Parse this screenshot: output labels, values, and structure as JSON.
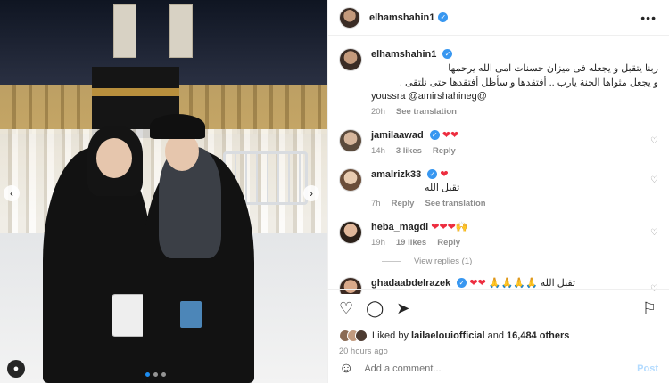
{
  "post": {
    "username": "elhamshahin1",
    "caption_ar_line1": "ربنا يتقبل و يجعله فى ميزان حسنات امى الله يرحمها",
    "caption_ar_line2": "و يجعل مثواها الجنة يارب .. أفتقدها و سأظل أفتقدها حتى نلتقى .",
    "caption_tag": "youssra @amirshahineg@",
    "caption_time": "20h",
    "see_translation": "See translation"
  },
  "comments": [
    {
      "username": "jamilaawad",
      "text": "❤❤",
      "time": "14h",
      "likes": "3 likes",
      "reply": "Reply"
    },
    {
      "username": "amalrizk33",
      "text": "❤",
      "arabic": "تقبل الله",
      "time": "7h",
      "reply": "Reply",
      "see_translation": "See translation"
    },
    {
      "username": "heba_magdi",
      "text": "❤❤❤🙌",
      "time": "19h",
      "likes": "19 likes",
      "reply": "Reply",
      "view_replies": "View replies (1)"
    },
    {
      "username": "ghadaabdelrazek",
      "text": "❤❤ 🙏🙏🙏🙏",
      "arabic": "تقبل الله"
    }
  ],
  "likes_text_prefix": "Liked by ",
  "likes_user": "lailaelouiofficial",
  "likes_text_mid": " and ",
  "likes_others": "16,484 others",
  "post_time": "20 hours ago",
  "add_comment_placeholder": "Add a comment...",
  "post_label": "Post",
  "photo_user_tag_icon": "person-icon"
}
